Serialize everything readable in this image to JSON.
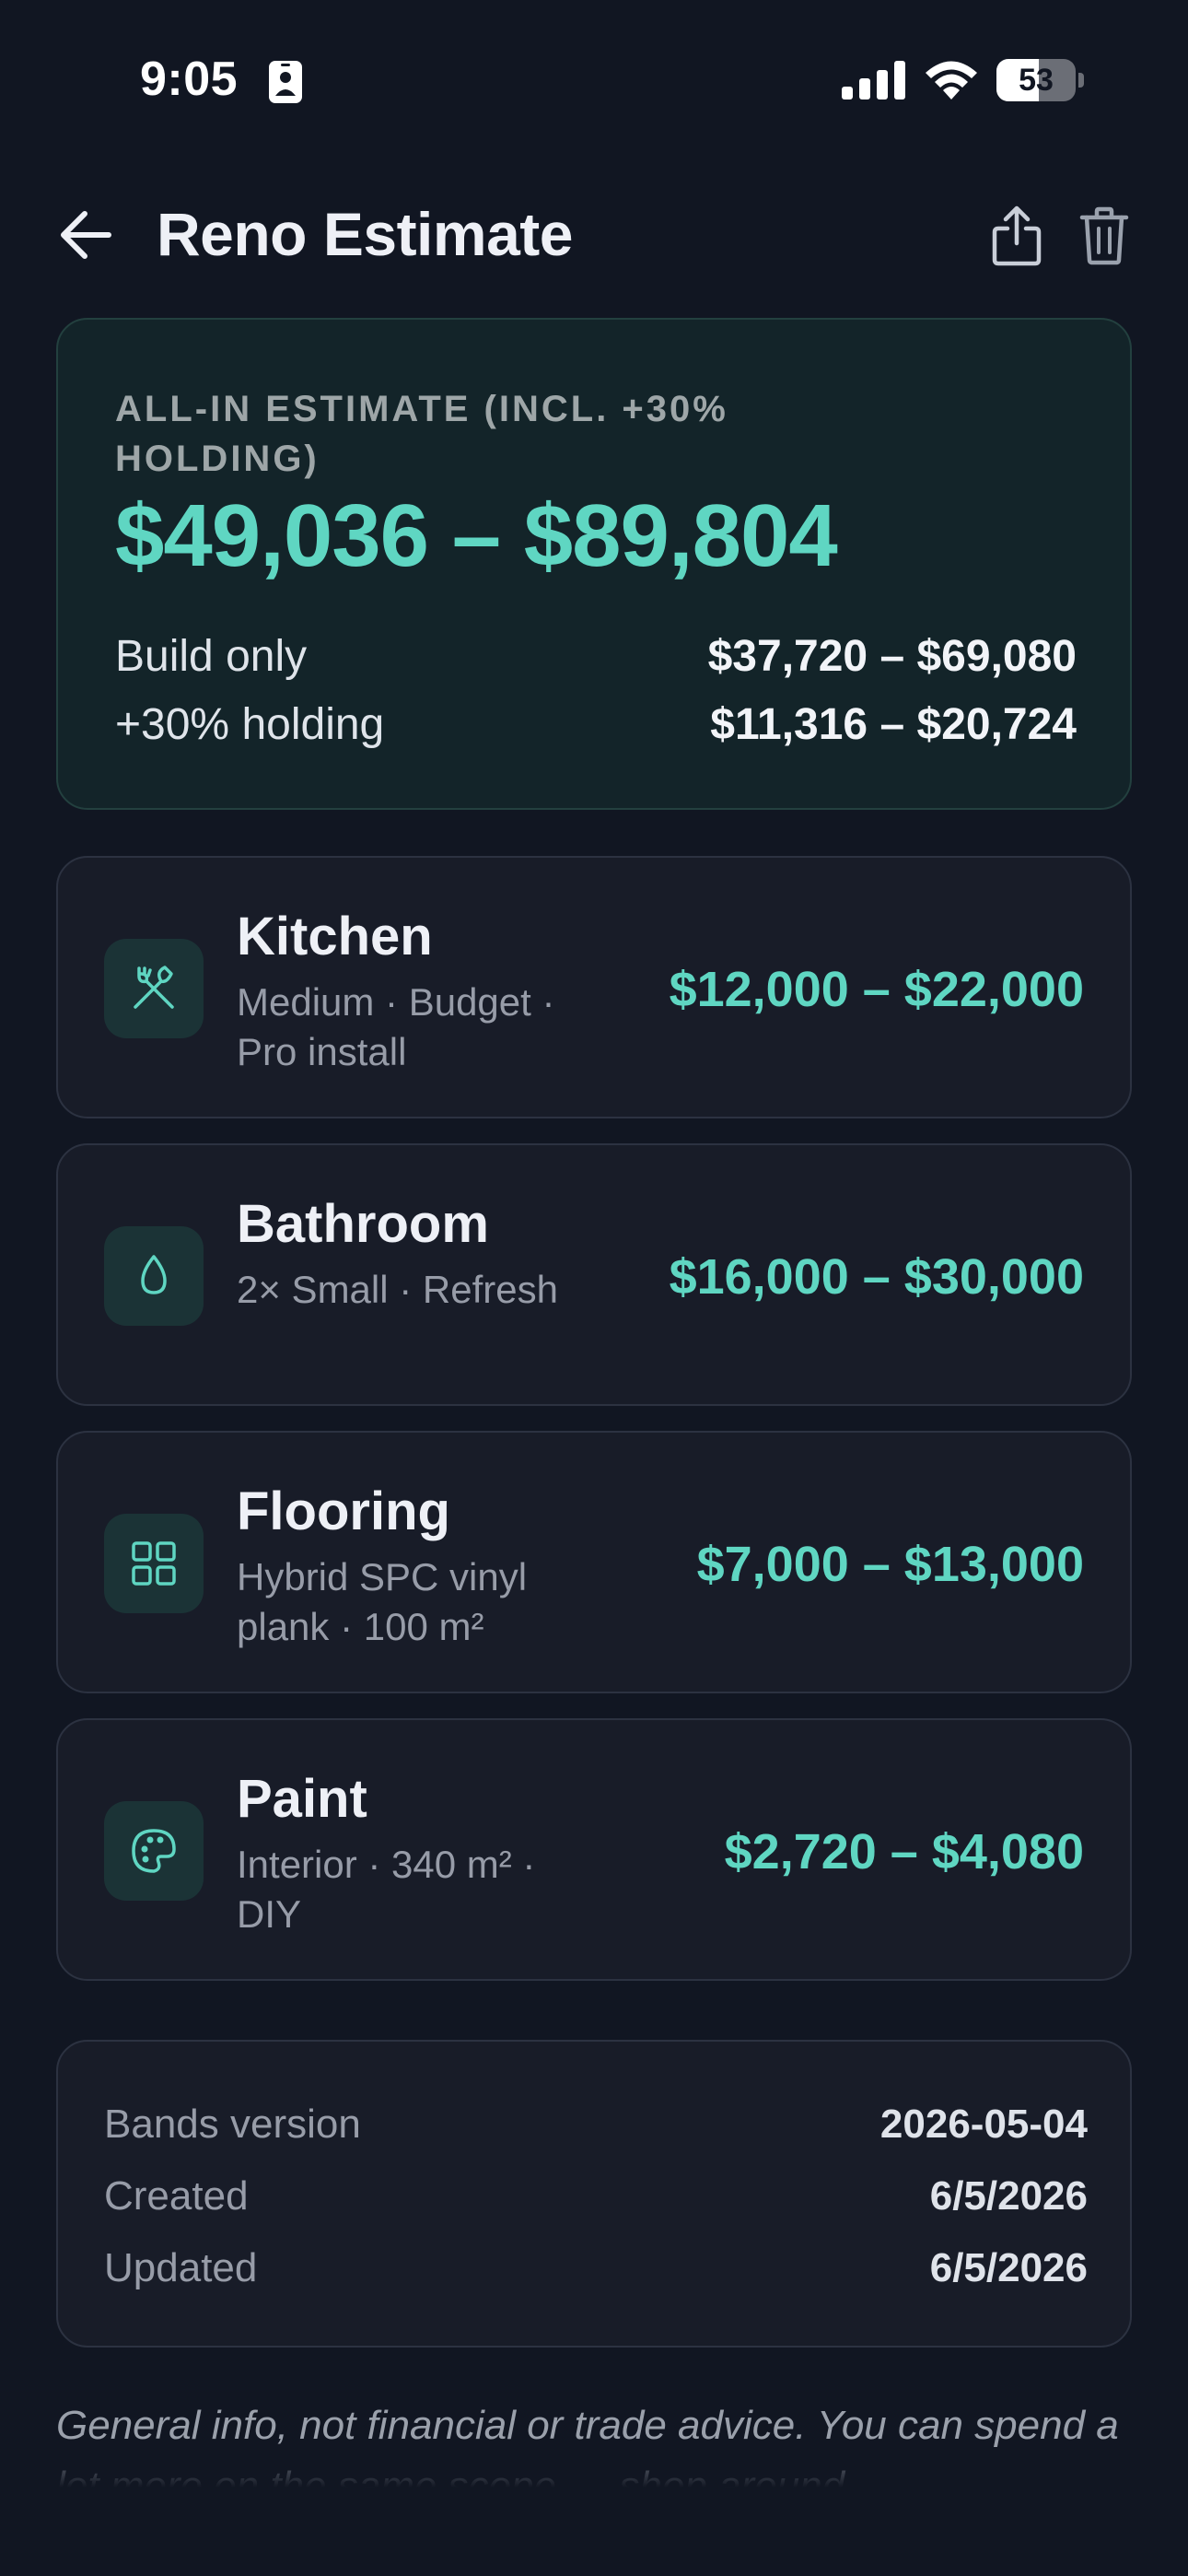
{
  "status_bar": {
    "time": "9:05",
    "battery_percent": "53",
    "battery_level": 0.53
  },
  "header": {
    "title": "Reno Estimate"
  },
  "summary": {
    "label": "ALL-IN ESTIMATE (INCL. +30% HOLDING)",
    "total": "$49,036 – $89,804",
    "rows": [
      {
        "label": "Build only",
        "value": "$37,720 – $69,080"
      },
      {
        "label": "+30% holding",
        "value": "$11,316 – $20,724"
      }
    ]
  },
  "categories": [
    {
      "name": "Kitchen",
      "description": "Medium · Budget · Pro install",
      "range": "$12,000 – $22,000",
      "icon": "utensils-icon"
    },
    {
      "name": "Bathroom",
      "description": "2× Small · Refresh",
      "range": "$16,000 – $30,000",
      "icon": "droplet-icon"
    },
    {
      "name": "Flooring",
      "description": "Hybrid SPC vinyl plank · 100 m²",
      "range": "$7,000 – $13,000",
      "icon": "grid-icon"
    },
    {
      "name": "Paint",
      "description": "Interior · 340 m² · DIY",
      "range": "$2,720 – $4,080",
      "icon": "palette-icon"
    }
  ],
  "meta": [
    {
      "label": "Bands version",
      "value": "2026-05-04"
    },
    {
      "label": "Created",
      "value": "6/5/2026"
    },
    {
      "label": "Updated",
      "value": "6/5/2026"
    }
  ],
  "disclaimer": "General info, not financial or trade advice. You can spend a lot more on the same scope — shop around.",
  "colors": {
    "background": "#111622",
    "accent": "#5fd6c2",
    "summary_card": "#132429",
    "card": "#181c28"
  }
}
